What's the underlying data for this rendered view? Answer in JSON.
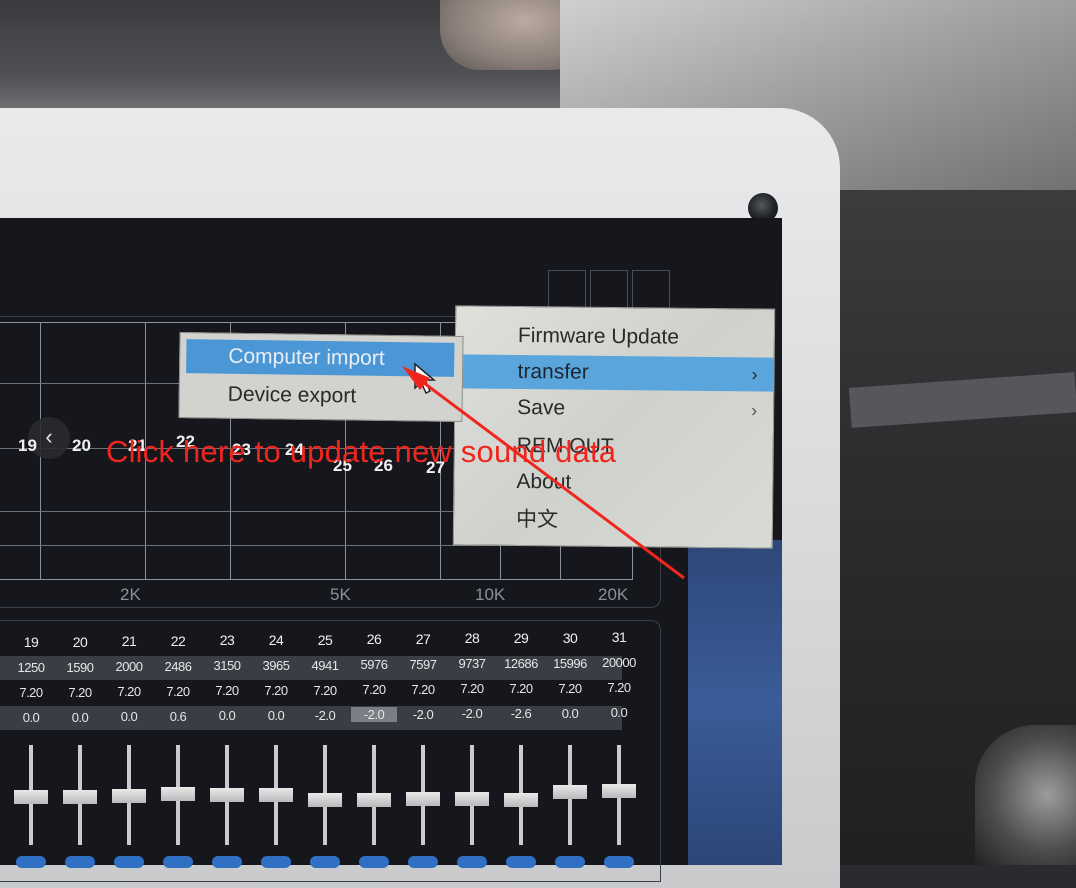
{
  "menu": {
    "items": [
      {
        "label": "Firmware Update",
        "has_submenu": false,
        "active": false
      },
      {
        "label": "transfer",
        "has_submenu": true,
        "active": true
      },
      {
        "label": "Save",
        "has_submenu": true,
        "active": false
      },
      {
        "label": "REM OUT",
        "has_submenu": false,
        "active": false
      },
      {
        "label": "About",
        "has_submenu": false,
        "active": false
      },
      {
        "label": "中文",
        "has_submenu": false,
        "active": false
      }
    ],
    "submenu_arrow": "›"
  },
  "submenu": {
    "items": [
      {
        "label": "Computer import",
        "active": true
      },
      {
        "label": "Device export",
        "active": false
      }
    ]
  },
  "annotation": {
    "text": "Click here to update new sound data",
    "color": "#f0261e"
  },
  "graph": {
    "band_numbers": [
      "19",
      "20",
      "21",
      "22",
      "23",
      "24",
      "25",
      "26",
      "27"
    ],
    "freq_labels": [
      "2K",
      "5K",
      "10K",
      "20K"
    ],
    "back_glyph": "‹"
  },
  "table": {
    "bands": [
      "19",
      "20",
      "21",
      "22",
      "23",
      "24",
      "25",
      "26",
      "27",
      "28",
      "29",
      "30",
      "31"
    ],
    "frequencies": [
      "1250",
      "1590",
      "2000",
      "2486",
      "3150",
      "3965",
      "4941",
      "5976",
      "7597",
      "9737",
      "12686",
      "15996",
      "20000"
    ],
    "q_values": [
      "7.20",
      "7.20",
      "7.20",
      "7.20",
      "7.20",
      "7.20",
      "7.20",
      "7.20",
      "7.20",
      "7.20",
      "7.20",
      "7.20",
      "7.20"
    ],
    "gains": [
      "0.0",
      "0.0",
      "0.0",
      "0.6",
      "0.0",
      "0.0",
      "-2.0",
      "-2.0",
      "-2.0",
      "-2.0",
      "-2.6",
      "0.0",
      "0.0"
    ],
    "selected_band": "26"
  },
  "colors": {
    "menu_highlight": "#5aa6dc",
    "submenu_highlight": "#4b97d6",
    "screen_bg": "#15171c"
  },
  "icons": [
    "chevron-left-icon",
    "chevron-right-icon",
    "mouse-cursor-icon",
    "red-arrow-annotation"
  ]
}
